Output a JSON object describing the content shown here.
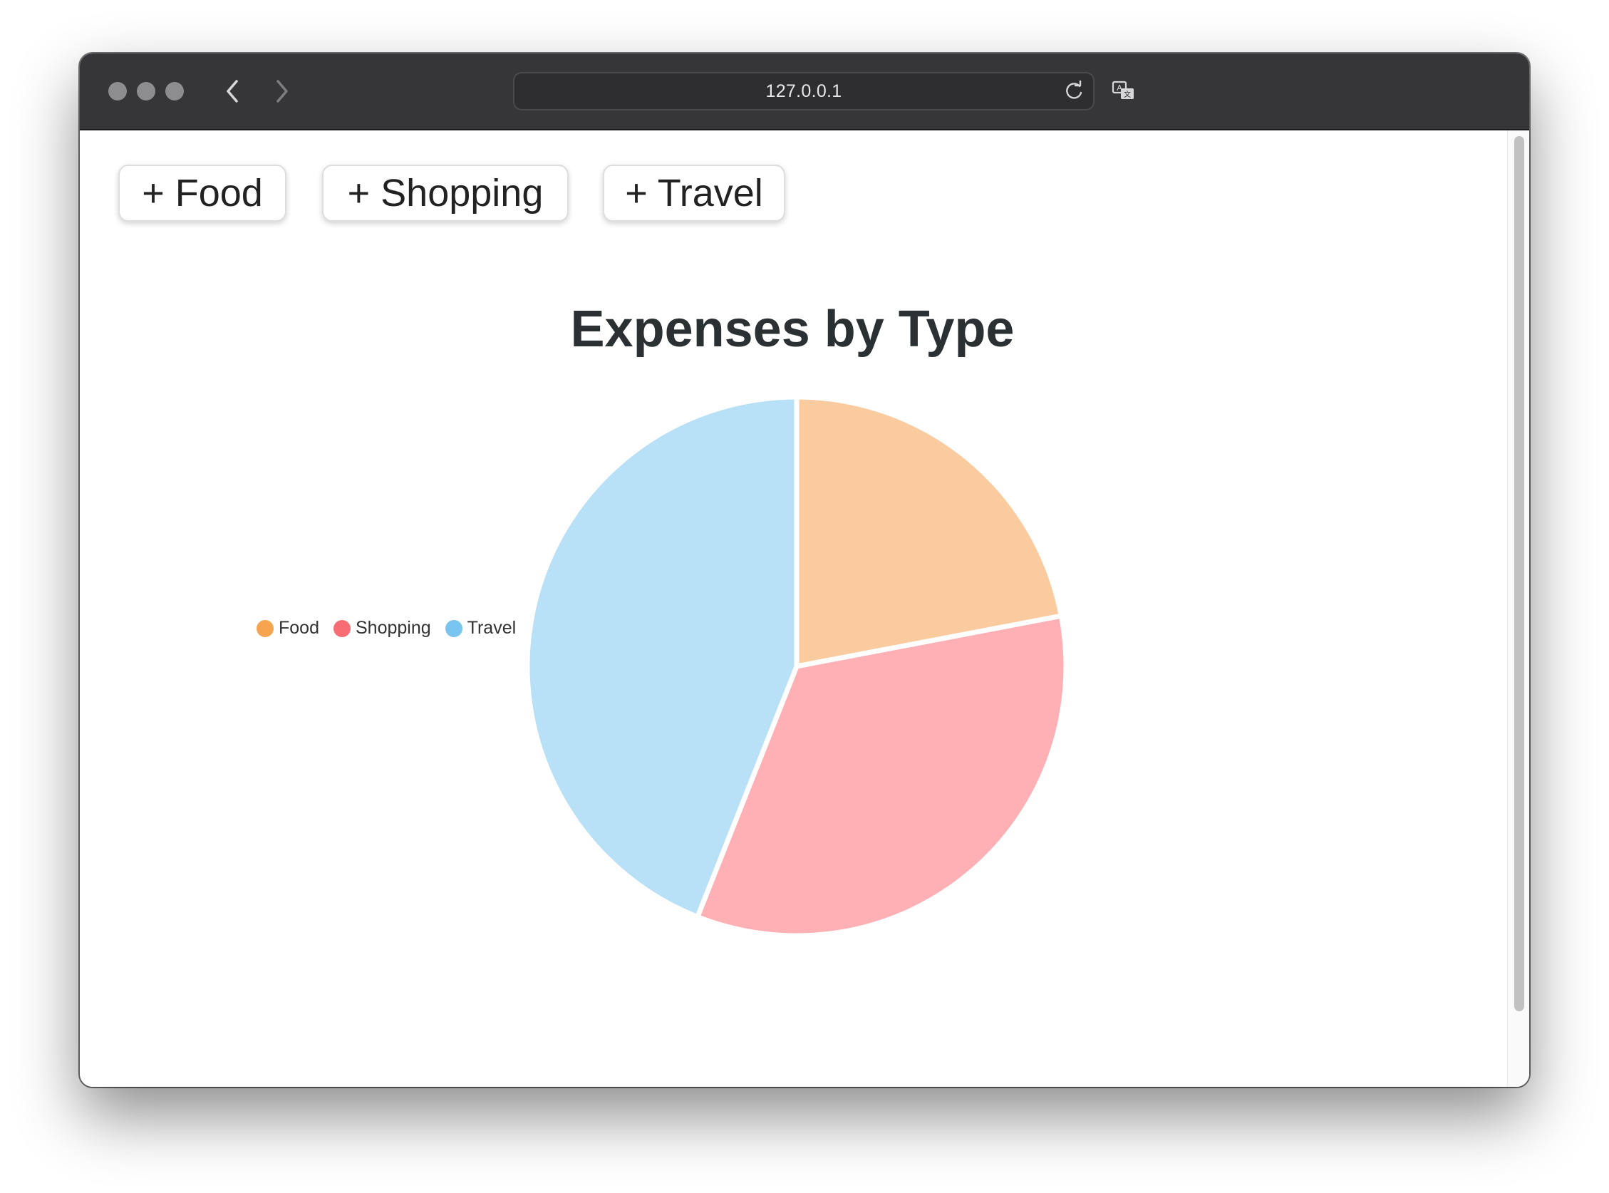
{
  "browser": {
    "url": "127.0.0.1",
    "translate_icon": "translate-icon",
    "reload_icon": "reload-icon",
    "back_icon": "chevron-left-icon",
    "forward_icon": "chevron-right-icon"
  },
  "toolbar": {
    "buttons": [
      {
        "label": "+ Food"
      },
      {
        "label": "+ Shopping"
      },
      {
        "label": "+ Travel"
      }
    ]
  },
  "colors": {
    "food": "#fbcba0",
    "shopping": "#ffb0b4",
    "travel": "#b8e0f6",
    "food_legend": "#f7a450",
    "shopping_legend": "#f76d73",
    "travel_legend": "#7ac5ef"
  },
  "chart_data": {
    "type": "pie",
    "title": "Expenses by Type",
    "legend_position": "left",
    "categories": [
      "Food",
      "Shopping",
      "Travel"
    ],
    "values": [
      22,
      34,
      44
    ]
  }
}
